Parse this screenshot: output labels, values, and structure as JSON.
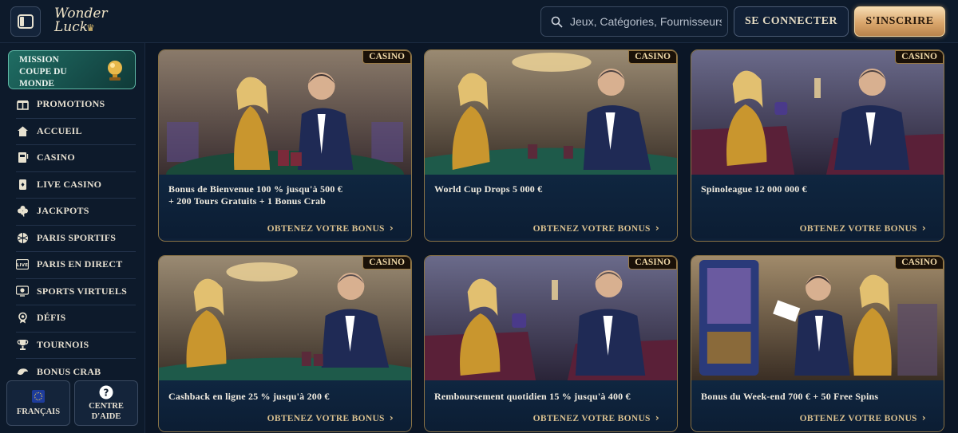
{
  "header": {
    "logo_line1": "Wonder",
    "logo_line2": "Luck",
    "search_placeholder": "Jeux, Catégories, Fournisseurs",
    "login_label": "SE CONNECTER",
    "signup_label": "S'INSCRIRE"
  },
  "sidebar": {
    "mission_lines": [
      "MISSION",
      "COUPE DU",
      "MONDE"
    ],
    "items": [
      {
        "label": "PROMOTIONS",
        "icon": "gift-icon"
      },
      {
        "label": "ACCUEIL",
        "icon": "home-icon"
      },
      {
        "label": "CASINO",
        "icon": "slot-machine-icon"
      },
      {
        "label": "LIVE CASINO",
        "icon": "playing-card-icon"
      },
      {
        "label": "JACKPOTS",
        "icon": "clover-icon"
      },
      {
        "label": "PARIS SPORTIFS",
        "icon": "ball-icon"
      },
      {
        "label": "PARIS EN DIRECT",
        "icon": "live-icon"
      },
      {
        "label": "SPORTS VIRTUELS",
        "icon": "virtual-sports-icon"
      },
      {
        "label": "DÉFIS",
        "icon": "medal-icon"
      },
      {
        "label": "TOURNOIS",
        "icon": "trophy-icon"
      },
      {
        "label": "BONUS CRAB",
        "icon": "crab-icon"
      }
    ],
    "language_label": "FRANÇAIS",
    "help_line1": "CENTRE",
    "help_line2": "D'AIDE"
  },
  "promotions": [
    {
      "badge": "CASINO",
      "title_line1": "Bonus de Bienvenue 100 % jusqu'à 500 €",
      "title_line2": "+ 200 Tours Gratuits + 1 Bonus Crab",
      "cta": "OBTENEZ VOTRE BONUS"
    },
    {
      "badge": "CASINO",
      "title_line1": "World Cup Drops 5 000 €",
      "title_line2": "",
      "cta": "OBTENEZ VOTRE BONUS"
    },
    {
      "badge": "CASINO",
      "title_line1": "Spinoleague 12 000 000 €",
      "title_line2": "",
      "cta": "OBTENEZ VOTRE BONUS"
    },
    {
      "badge": "CASINO",
      "title_line1": "Cashback en ligne 25 % jusqu'à 200 €",
      "title_line2": "",
      "cta": "OBTENEZ VOTRE BONUS"
    },
    {
      "badge": "CASINO",
      "title_line1": "Remboursement quotidien 15 % jusqu'à 400 €",
      "title_line2": "",
      "cta": "OBTENEZ VOTRE BONUS"
    },
    {
      "badge": "CASINO",
      "title_line1": "Bonus du Week-end 700 € + 50 Free Spins",
      "title_line2": "",
      "cta": "OBTENEZ VOTRE BONUS"
    }
  ],
  "colors": {
    "accent_gold": "#d8bf8e",
    "card_border": "#8a7346",
    "background": "#0b1626",
    "mission_green": "#1f6d63"
  }
}
